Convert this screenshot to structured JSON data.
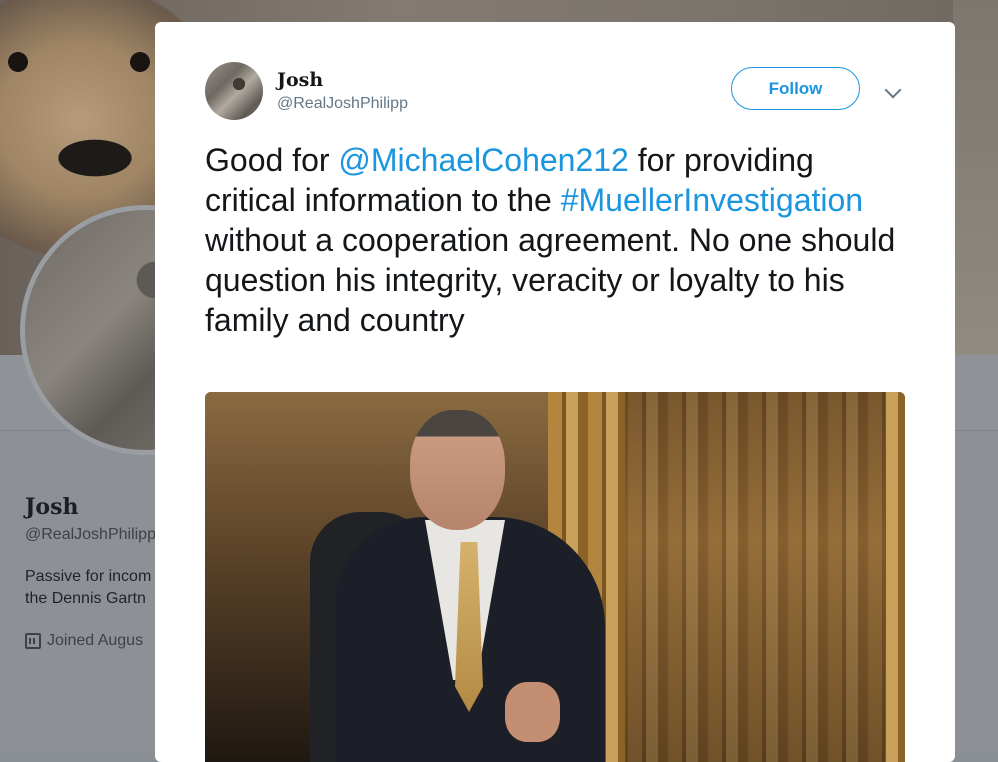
{
  "background_profile": {
    "name": "Josh",
    "handle": "@RealJoshPhilipp",
    "bio": "Passive for incom the Dennis Gartn",
    "joined": "Joined Augus"
  },
  "tweet": {
    "author_name": "Josh",
    "author_handle": "@RealJoshPhilipp",
    "follow_label": "Follow",
    "text_part1": "Good for ",
    "mention": "@MichaelCohen212",
    "text_part2": " for providing critical information to the ",
    "hashtag": "#MuellerInvestigation",
    "text_part3": " without a cooperation agreement. No one should question his integrity, veracity or loyalty to his family and country"
  },
  "colors": {
    "link": "#1b95e0",
    "text": "#14171a",
    "secondary": "#657786"
  },
  "icons": {
    "menu": "chevron-down-icon",
    "joined": "calendar-icon"
  }
}
